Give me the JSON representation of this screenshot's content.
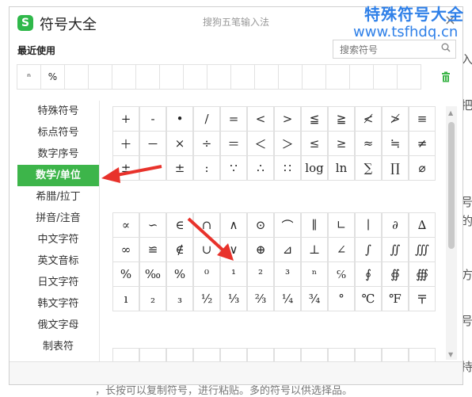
{
  "background": {
    "right_chars": [
      "入",
      "把",
      "号",
      "的",
      "方",
      "号",
      "持"
    ],
    "bottom_text": "，长按可以复制符号，进行粘贴。多的符号以供选择品。"
  },
  "watermark": {
    "line1": "特殊符号大全",
    "line2": "www.tsfhdq.cn"
  },
  "window": {
    "title": "符号大全",
    "logo": "S",
    "ime_name": "搜狗五笔输入法",
    "close": "×"
  },
  "recent": {
    "label": "最近使用",
    "items": [
      "ⁿ",
      "%",
      "",
      "",
      "",
      "",
      "",
      "",
      "",
      "",
      "",
      "",
      "",
      "",
      "",
      "",
      ""
    ]
  },
  "search": {
    "placeholder": "搜索符号"
  },
  "sidebar": {
    "items": [
      "特殊符号",
      "标点符号",
      "数字序号",
      "数学/单位",
      "希腊/拉丁",
      "拼音/注音",
      "中文字符",
      "英文音标",
      "日文字符",
      "韩文字符",
      "俄文字母",
      "制表符"
    ],
    "active_index": 3
  },
  "grid1": [
    "+",
    "-",
    "•",
    "/",
    "=",
    "<",
    ">",
    "≦",
    "≧",
    "≮",
    "≯",
    "≡",
    "＋",
    "－",
    "×",
    "÷",
    "＝",
    "＜",
    "＞",
    "≤",
    "≥",
    "≈",
    "≒",
    "≠",
    "±",
    "−",
    "±",
    ":",
    "∵",
    "∴",
    "∷",
    "log",
    "ln",
    "∑",
    "∏",
    "⌀"
  ],
  "grid2": [
    "∝",
    "∽",
    "∈",
    "∩",
    "∧",
    "⊙",
    "⌒",
    "∥",
    "∟",
    "∣",
    "∂",
    "∆",
    "∞",
    "≌",
    "∉",
    "∪",
    "∨",
    "⊕",
    "⊿",
    "⊥",
    "∠",
    "∫",
    "∬",
    "∭",
    "%",
    "‰",
    "%",
    "⁰",
    "¹",
    "²",
    "³",
    "ⁿ",
    "℅",
    "∮",
    "∯",
    "∰",
    "ı",
    "₂",
    "₃",
    "½",
    "⅓",
    "⅔",
    "¼",
    "¾",
    "°",
    "℃",
    "℉",
    "〒"
  ],
  "grid3": [
    "",
    "",
    "",
    "",
    "",
    "",
    "",
    "",
    "",
    "",
    "",
    ""
  ],
  "colors": {
    "accent": "#3db54a",
    "watermark": "#2f80e8",
    "arrow": "#e8322b"
  }
}
